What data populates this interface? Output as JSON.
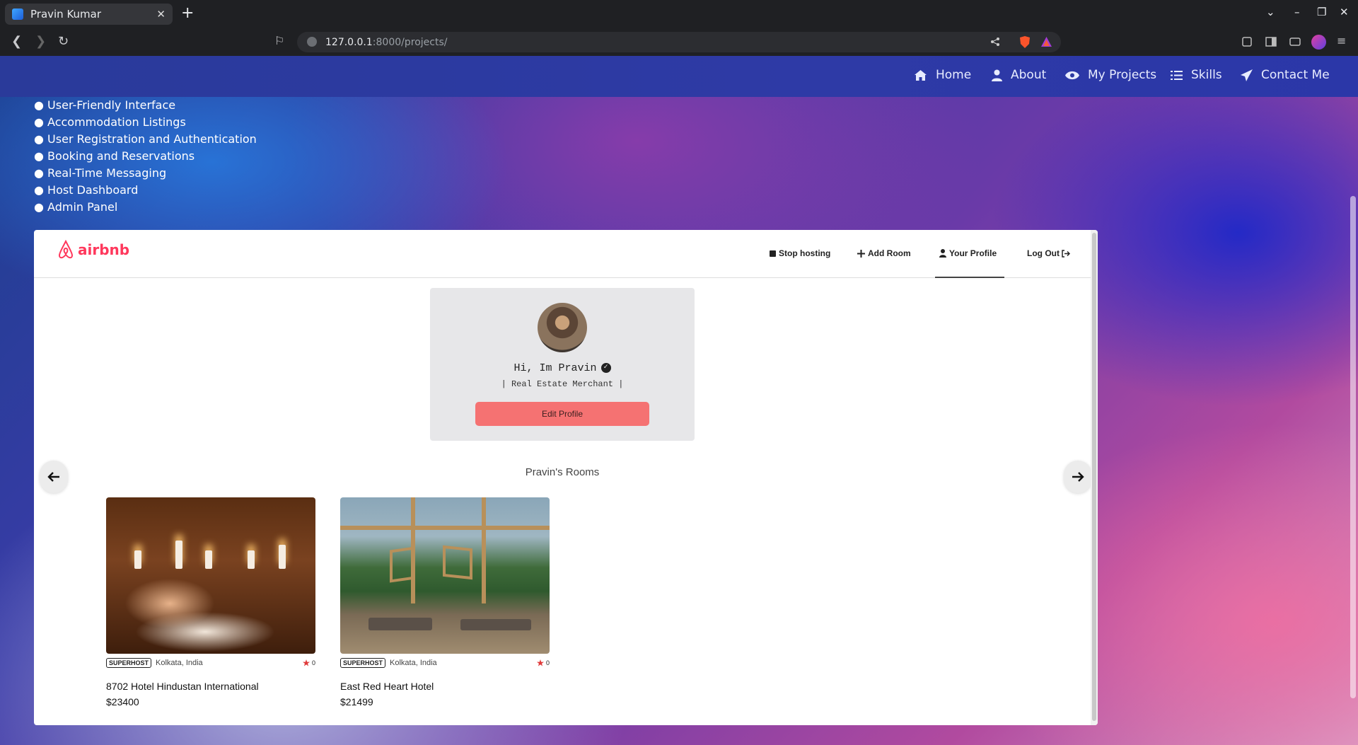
{
  "browser": {
    "tab_title": "Pravin Kumar",
    "url_host": "127.0.0.1",
    "url_path": ":8000/projects/"
  },
  "navbar": {
    "items": [
      {
        "label": "Home",
        "icon": "home-icon"
      },
      {
        "label": "About",
        "icon": "user-icon"
      },
      {
        "label": "My Projects",
        "icon": "eye-icon"
      },
      {
        "label": "Skills",
        "icon": "list-icon"
      },
      {
        "label": "Contact Me",
        "icon": "send-icon"
      }
    ]
  },
  "features": [
    "User-Friendly Interface",
    "Accommodation Listings",
    "User Registration and Authentication",
    "Booking and Reservations",
    "Real-Time Messaging",
    "Host Dashboard",
    "Admin Panel"
  ],
  "airbnb": {
    "logo_text": "airbnb",
    "brand_color": "#ff385c",
    "nav": {
      "stop_hosting": "Stop hosting",
      "add_room": "Add Room",
      "your_profile": "Your Profile",
      "log_out": "Log Out"
    },
    "profile": {
      "greeting": "Hi, Im Pravin",
      "role": "| Real Estate Merchant |",
      "edit_button": "Edit Profile"
    },
    "rooms_title": "Pravin's Rooms",
    "rooms": [
      {
        "badge": "SUPERHOST",
        "location": "Kolkata, India",
        "rating": "0",
        "name": "8702 Hotel Hindustan International",
        "price": "$23400"
      },
      {
        "badge": "SUPERHOST",
        "location": "Kolkata, India",
        "rating": "0",
        "name": "East Red Heart Hotel",
        "price": "$21499"
      }
    ]
  }
}
